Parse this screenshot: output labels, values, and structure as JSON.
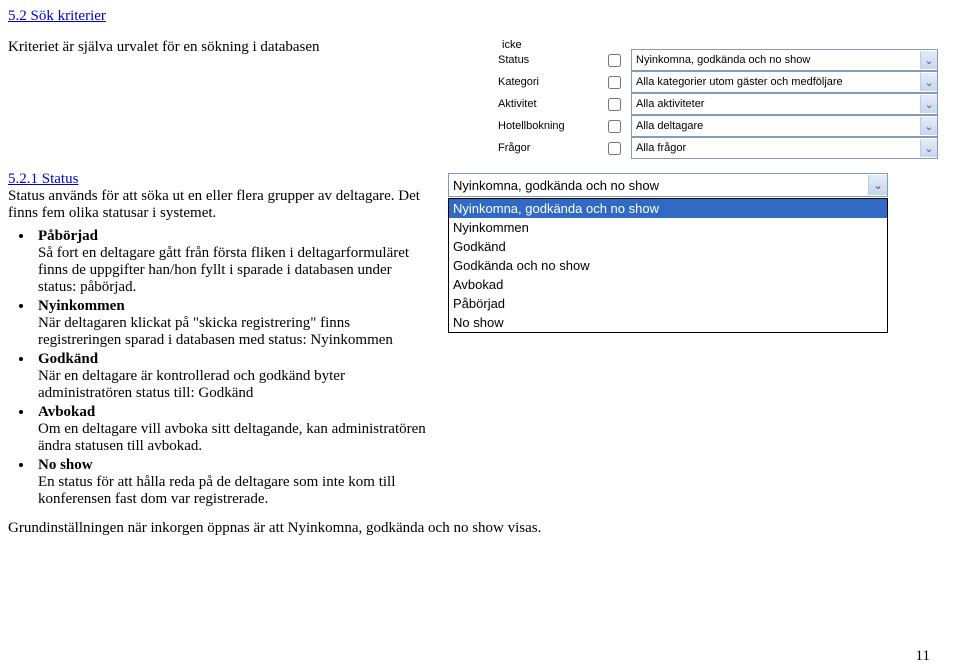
{
  "heading": "5.2 Sök kriterier",
  "intro": "Kriteriet är själva urvalet för en sökning i databasen",
  "filters": {
    "icke_label": "icke",
    "rows": [
      {
        "label": "Status",
        "value": "Nyinkomna, godkända och no show"
      },
      {
        "label": "Kategori",
        "value": "Alla kategorier utom gäster och medföljare"
      },
      {
        "label": "Aktivitet",
        "value": "Alla aktiviteter"
      },
      {
        "label": "Hotellbokning",
        "value": "Alla deltagare"
      },
      {
        "label": "Frågor",
        "value": "Alla frågor"
      }
    ]
  },
  "status_section": {
    "title": "5.2.1 Status",
    "lead": "Status används för att söka ut en eller flera grupper av deltagare. Det finns fem olika statusar i systemet.",
    "items": [
      {
        "name": "Påbörjad",
        "text": "Så fort en deltagare gått från första fliken i deltagarformuläret finns de uppgifter han/hon fyllt i sparade i databasen under status: påbörjad."
      },
      {
        "name": "Nyinkommen",
        "text": "När deltagaren klickat på \"skicka registrering\" finns registreringen sparad i databasen med status: Nyinkommen"
      },
      {
        "name": "Godkänd",
        "text": "När en deltagare är kontrollerad och godkänd byter administratören status till: Godkänd"
      },
      {
        "name": "Avbokad",
        "text": "Om en deltagare vill avboka sitt deltagande, kan administratören ändra statusen till avbokad."
      },
      {
        "name": "No show",
        "text": "En status för att hålla reda på de deltagare som inte kom till konferensen fast dom var registrerade."
      }
    ]
  },
  "dropdown": {
    "selected": "Nyinkomna, godkända och no show",
    "options": [
      "Nyinkomna, godkända och no show",
      "Nyinkommen",
      "Godkänd",
      "Godkända och no show",
      "Avbokad",
      "Påbörjad",
      "No show"
    ]
  },
  "closing": "Grundinställningen när inkorgen öppnas är att Nyinkomna, godkända och no show visas.",
  "page_number": "11"
}
